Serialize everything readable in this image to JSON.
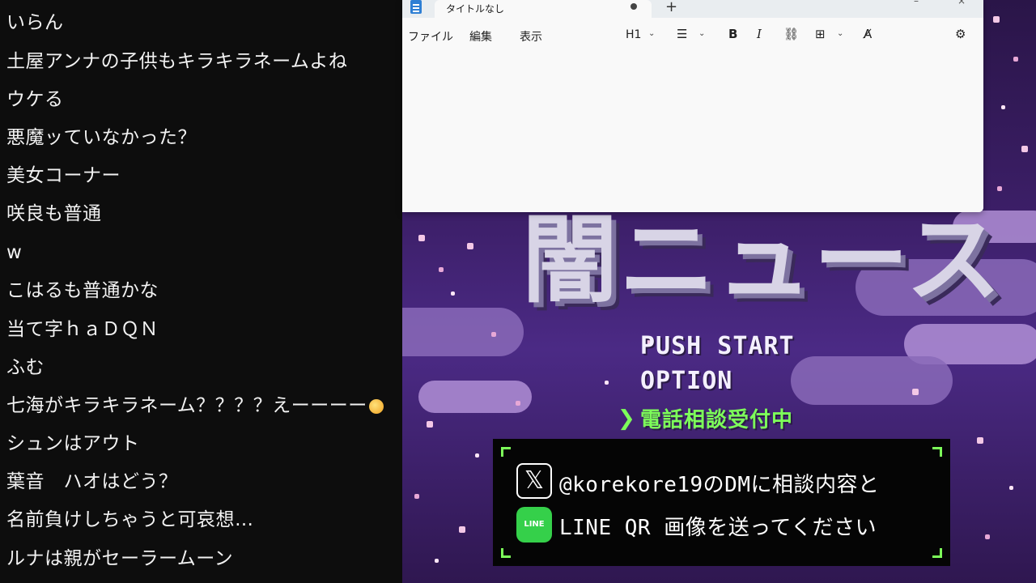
{
  "chat": {
    "messages": [
      "いらん",
      "土屋アンナの子供もキラキラネームよね",
      "ウケる",
      "悪魔ッていなかった？",
      "美女コーナー",
      "咲良も普通",
      "w",
      "こはるも普通かな",
      "当て字ｈａＤＱＮ",
      "ふむ",
      "七海がキラキラネーム？？？？えーーーー",
      "シュンはアウト",
      "葉音　ハオはどう？",
      "名前負けしちゃうと可哀想…",
      "ルナは親がセーラームーン"
    ]
  },
  "notepad": {
    "tab_title": "タイトルなし",
    "new_tab": "+",
    "menus": {
      "file": "ファイル",
      "edit": "編集",
      "view": "表示"
    },
    "toolbar": {
      "heading": "H1",
      "heading_chevron": "⌄",
      "list_icon": "☰",
      "list_chevron": "⌄",
      "bold": "B",
      "italic": "I",
      "link_icon": "⛓",
      "table_icon": "⊞",
      "table_chevron": "⌄",
      "clear_format": "A̸",
      "settings_icon": "⚙"
    },
    "window_minimize": "–",
    "window_close": "×"
  },
  "game": {
    "title": "闇ニュース",
    "menu": {
      "start": "PUSH START",
      "option": "OPTION",
      "selected_marker": "❯",
      "selected": "電話相談受付中"
    },
    "info": {
      "x_icon_glyph": "𝕏",
      "line_icon_text": "LINE",
      "line1": "@korekore19のDMに相談内容と",
      "line2": "LINE QR 画像を送ってください"
    },
    "colors": {
      "accent_green": "#7dff5a",
      "sky_purple": "#4b2a85"
    }
  }
}
